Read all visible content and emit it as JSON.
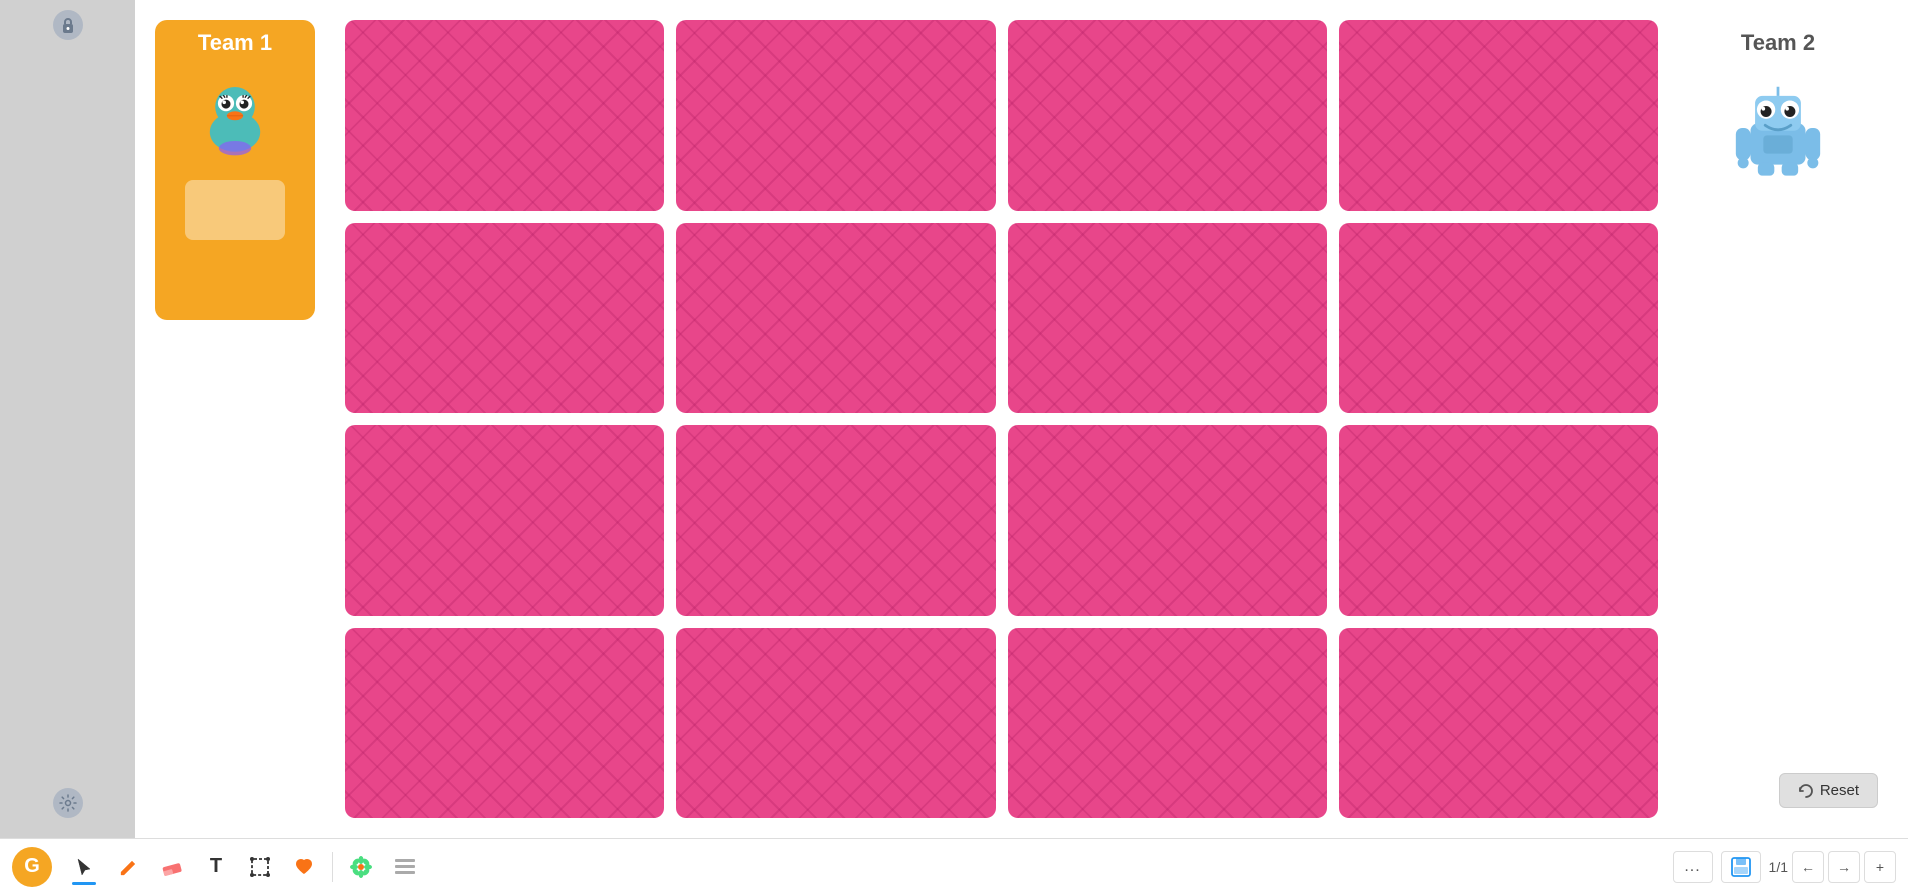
{
  "app": {
    "brand_letter": "G"
  },
  "team1": {
    "title": "Team 1",
    "avatar_alt": "duck-avatar"
  },
  "team2": {
    "title": "Team 2",
    "avatar_alt": "robot-avatar"
  },
  "cards": {
    "count": 16,
    "rows": 4,
    "cols": 4
  },
  "toolbar": {
    "cursor_label": "Cursor",
    "pencil_label": "Pencil",
    "eraser_label": "Eraser",
    "text_label": "Text",
    "select_label": "Select",
    "heart_label": "Heart",
    "flower_label": "Flower",
    "list_label": "List",
    "more_label": "...",
    "save_label": "Save",
    "page_current": "1",
    "page_total": "1",
    "page_display": "1/1",
    "prev_label": "←",
    "next_label": "→",
    "add_label": "+"
  },
  "controls": {
    "lock_icon": "🔒",
    "settings_icon": "⚙",
    "reset_label": "Reset"
  }
}
